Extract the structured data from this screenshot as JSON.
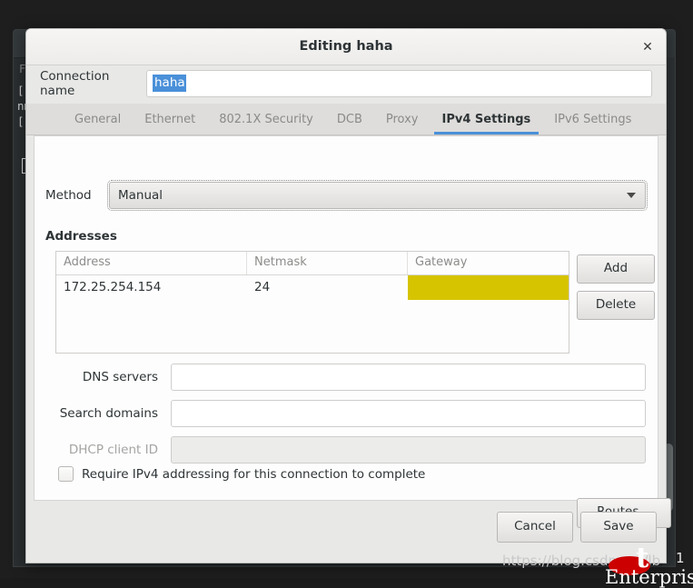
{
  "background": {
    "terminal_menu": "F",
    "terminal_lines": "[ r\nnm\n[ r"
  },
  "dialog": {
    "title": "Editing haha",
    "close_icon": "close-icon",
    "connection_name": {
      "label": "Connection name",
      "value": "haha",
      "selected": true
    },
    "tabs": [
      {
        "label": "General",
        "active": false
      },
      {
        "label": "Ethernet",
        "active": false
      },
      {
        "label": "802.1X Security",
        "active": false
      },
      {
        "label": "DCB",
        "active": false
      },
      {
        "label": "Proxy",
        "active": false
      },
      {
        "label": "IPv4 Settings",
        "active": true
      },
      {
        "label": "IPv6 Settings",
        "active": false
      }
    ],
    "method": {
      "label": "Method",
      "value": "Manual",
      "arrow_icon": "chevron-down-icon"
    },
    "addresses": {
      "section_label": "Addresses",
      "columns": [
        "Address",
        "Netmask",
        "Gateway"
      ],
      "rows": [
        {
          "address": "172.25.254.154",
          "netmask": "24",
          "gateway": ""
        }
      ],
      "editing_cell": "gateway",
      "editing_color": "#d6c400",
      "add_label": "Add",
      "delete_label": "Delete"
    },
    "dns_servers": {
      "label": "DNS servers",
      "value": "",
      "placeholder": ""
    },
    "search_domains": {
      "label": "Search domains",
      "value": "",
      "placeholder": ""
    },
    "dhcp_client_id": {
      "label": "DHCP client ID",
      "value": "",
      "placeholder": "",
      "disabled": true
    },
    "require_ipv4": {
      "label": "Require IPv4 addressing for this connection to complete",
      "checked": false
    },
    "routes_label": "Routes…",
    "cancel_label": "Cancel",
    "save_label": "Save"
  },
  "watermark": {
    "url": "https://blog.csdn.net/lb",
    "hat_text": "t",
    "enterprise_text": "Enterprise",
    "trailing": "1"
  },
  "colors": {
    "accent": "#4a90d9",
    "editing_cell": "#d6c400",
    "dialog_bg": "#e8e8e7",
    "watermark_red": "#cc0000"
  }
}
